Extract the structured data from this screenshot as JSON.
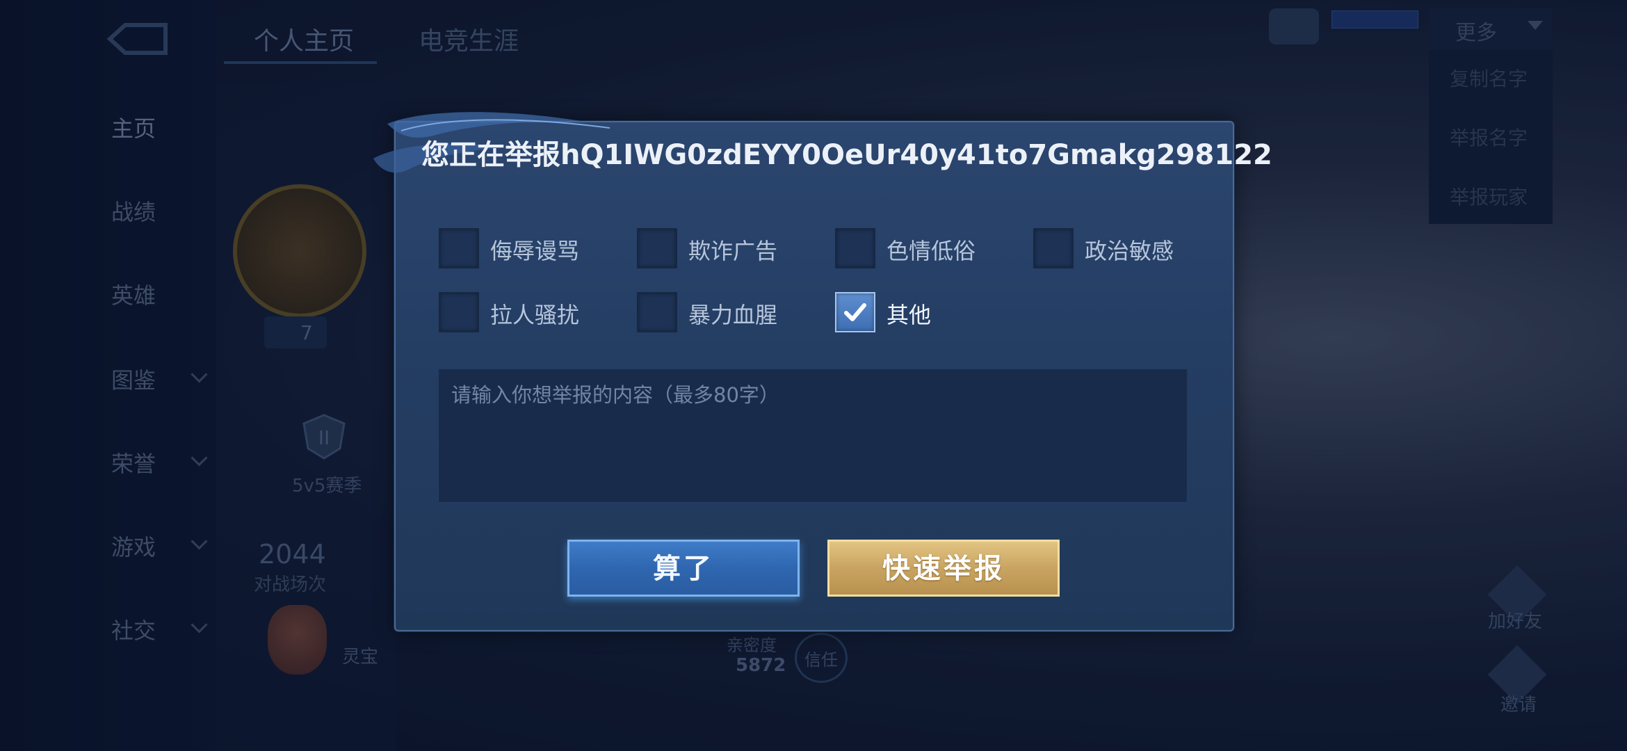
{
  "background": {
    "tabs": [
      "个人主页",
      "电竞生涯"
    ],
    "sidebar": [
      "主页",
      "战绩",
      "英雄",
      "图鉴",
      "荣誉",
      "游戏",
      "社交"
    ],
    "level": "7",
    "season_label": "5v5赛季",
    "matches_value": "2044",
    "matches_label": "对战场次",
    "lingbao_name": "灵宝",
    "intimacy_label": "亲密度",
    "intimacy_value": "5872",
    "trust_label": "信任",
    "more_button": "更多",
    "more_menu": [
      "复制名字",
      "举报名字",
      "举报玩家"
    ],
    "right_labels": [
      "加好友",
      "邀请"
    ]
  },
  "dialog": {
    "title": "您正在举报hQ1IWG0zdEYY0OeUr40y41to7Gmakg298122",
    "options": [
      {
        "label": "侮辱谩骂",
        "checked": false
      },
      {
        "label": "欺诈广告",
        "checked": false
      },
      {
        "label": "色情低俗",
        "checked": false
      },
      {
        "label": "政治敏感",
        "checked": false
      },
      {
        "label": "拉人骚扰",
        "checked": false
      },
      {
        "label": "暴力血腥",
        "checked": false
      },
      {
        "label": "其他",
        "checked": true
      }
    ],
    "input": {
      "placeholder": "请输入你想举报的内容（最多80字）",
      "value": ""
    },
    "cancel_label": "算了",
    "report_label": "快速举报"
  },
  "colors": {
    "accent_blue": "#3f7cc8",
    "accent_gold": "#c9a461",
    "dialog_bg": "#243d63"
  },
  "icons": [
    "back-icon",
    "chat-icon",
    "checkmark-icon",
    "rank-icon",
    "add-friend-icon",
    "invite-icon"
  ]
}
